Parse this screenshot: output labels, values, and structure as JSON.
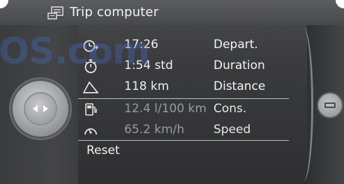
{
  "title_bar": {
    "title": "Trip computer",
    "icon": "trip-computer-icon"
  },
  "rows": [
    {
      "icon": "departure-clock-icon",
      "value": "17:26",
      "label": "Depart."
    },
    {
      "icon": "stopwatch-icon",
      "value": "1:54 std",
      "label": "Duration"
    },
    {
      "icon": "distance-road-icon",
      "value": "118 km",
      "label": "Distance"
    },
    {
      "icon": "fuel-pump-icon",
      "value": "12.4 l/100 km",
      "label": "Cons."
    },
    {
      "icon": "speedometer-icon",
      "value": "65.2 km/h",
      "label": "Speed"
    }
  ],
  "reset_label": "Reset",
  "watermark": "OS.com",
  "controls": {
    "left_controller": "controller-arrows-icon",
    "right_knob": "option-menu-icon"
  },
  "colors": {
    "background": "#3a3b3d",
    "text_primary": "#f5f5f5",
    "text_dim": "#9a9b9e",
    "separator": "#bdbec0",
    "watermark": "#466ec8"
  }
}
